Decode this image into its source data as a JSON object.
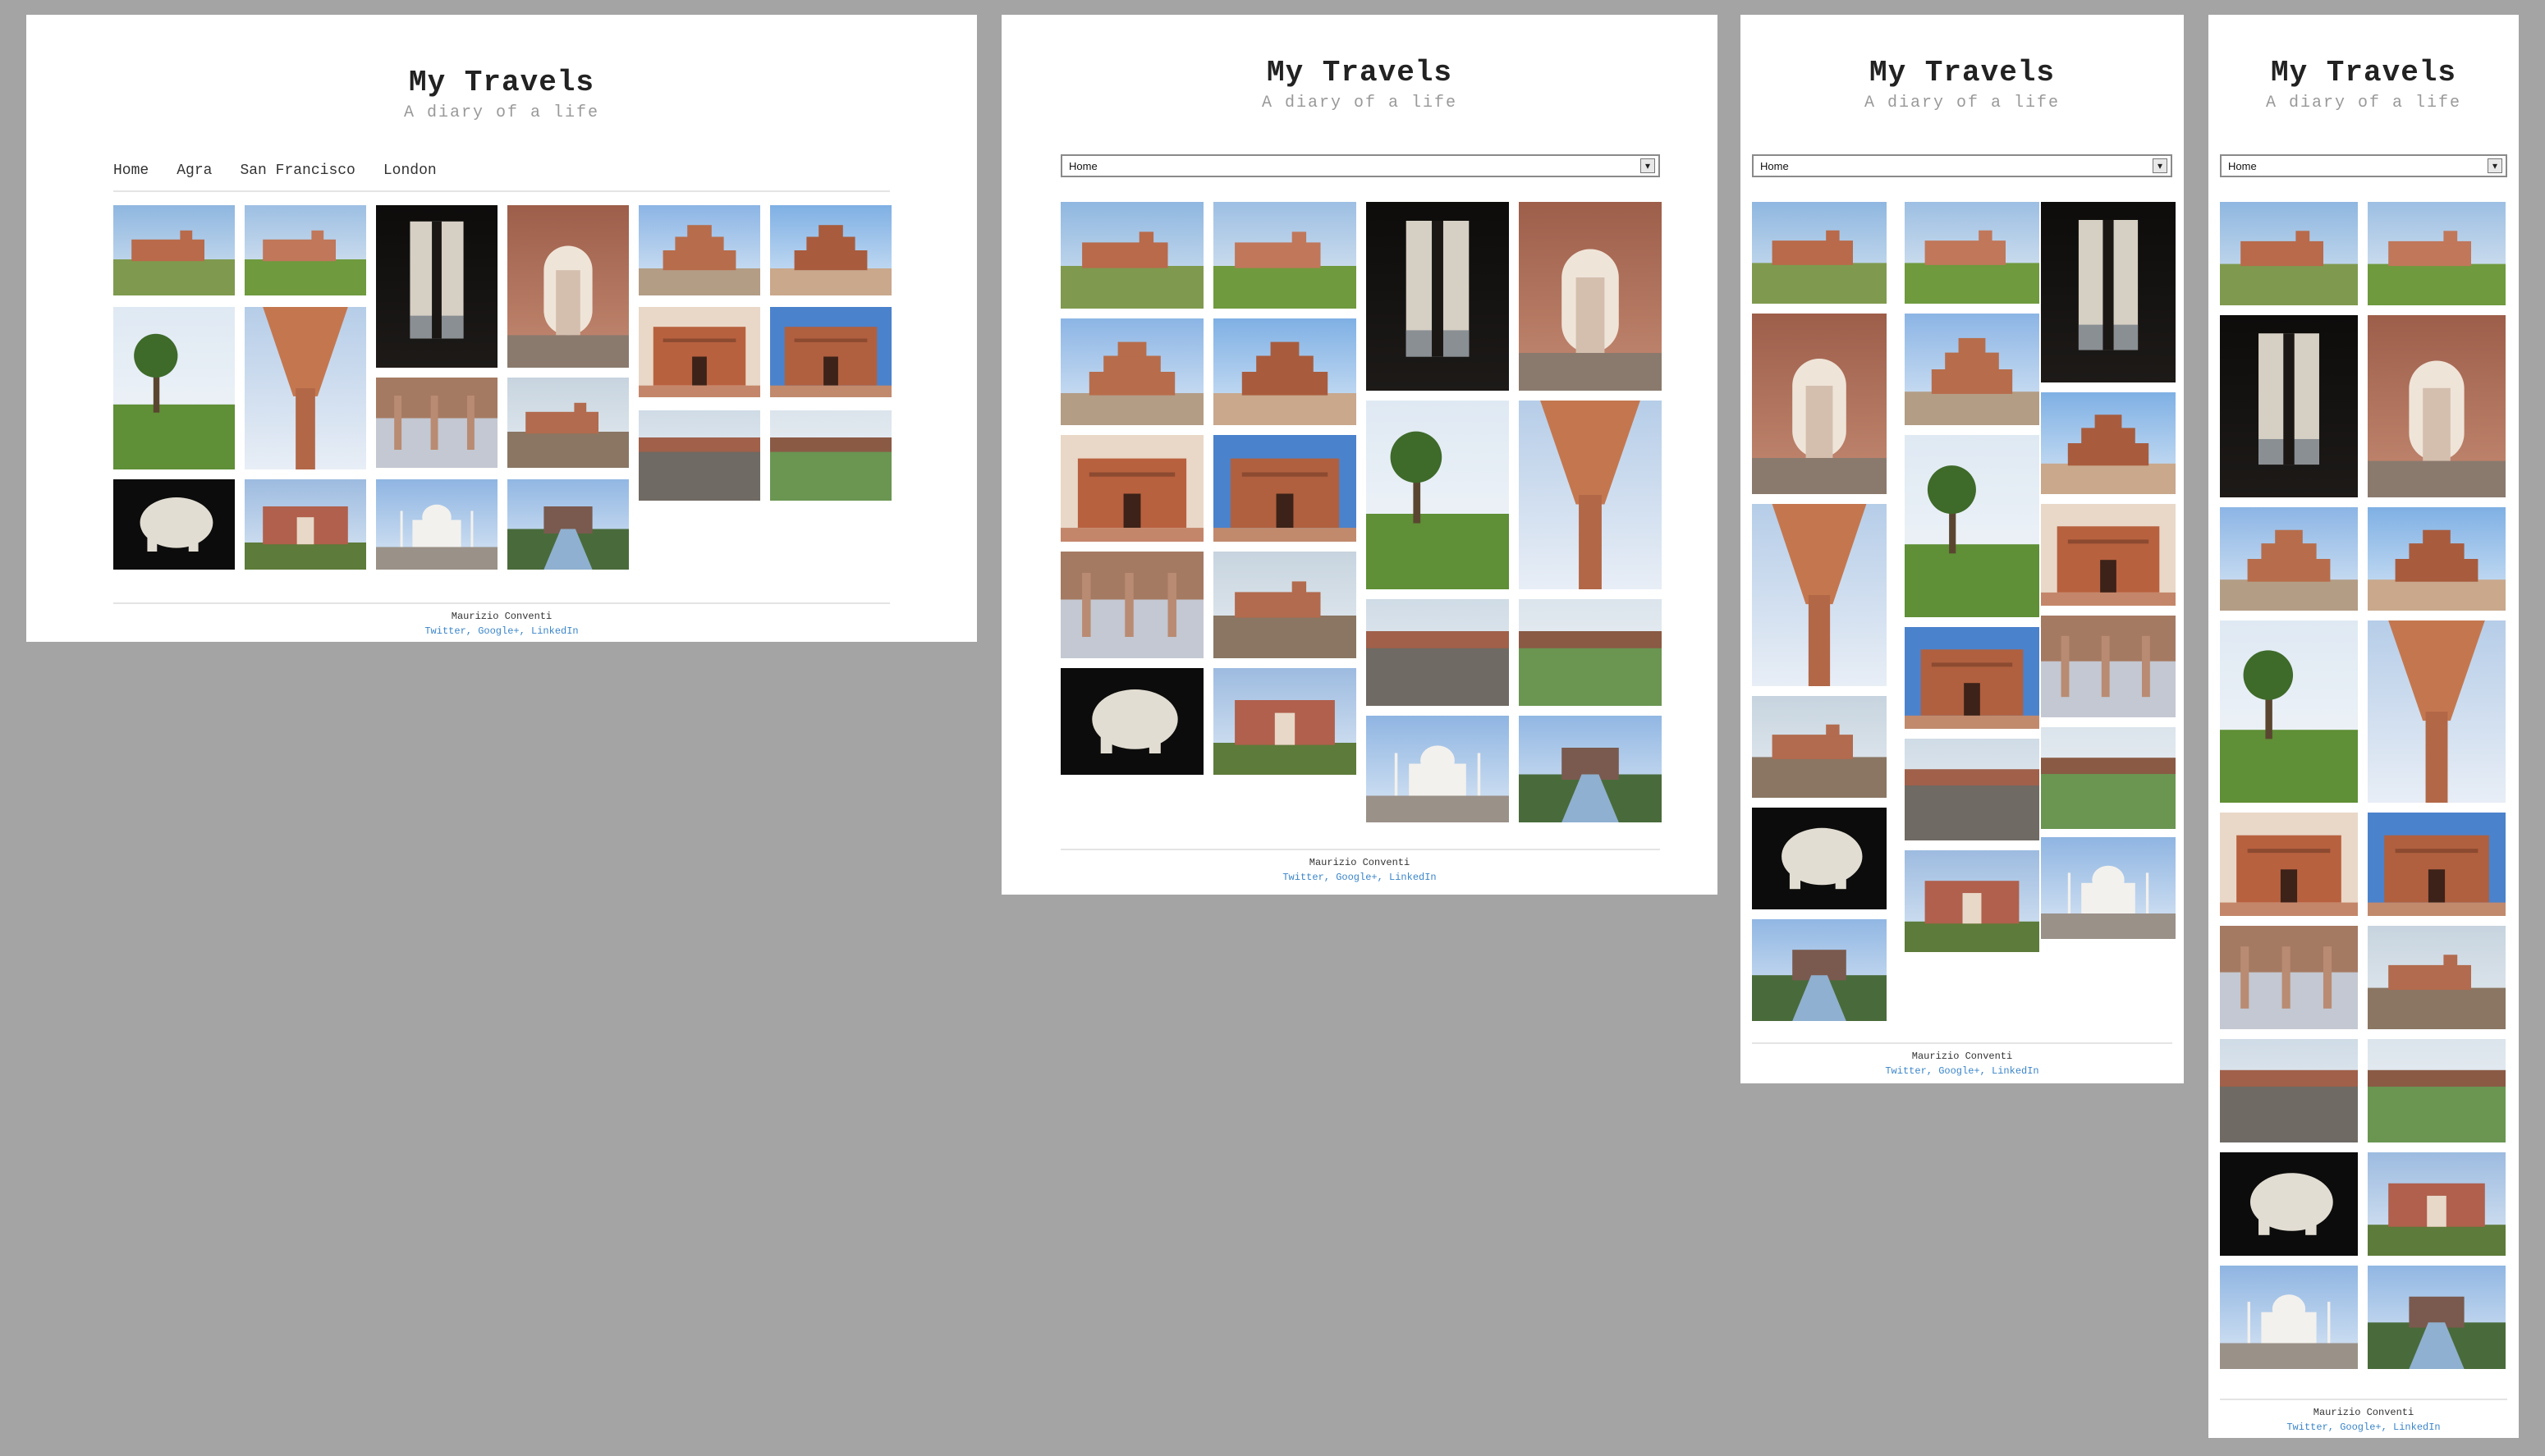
{
  "site": {
    "title": "My Travels",
    "subtitle": "A diary of a life"
  },
  "nav": {
    "items": [
      "Home",
      "Agra",
      "San Francisco",
      "London"
    ],
    "selected": "Home"
  },
  "footer": {
    "author": "Maurizio Conventi",
    "links": [
      "Twitter",
      "Google+",
      "LinkedIn"
    ],
    "separator": ","
  },
  "colors": {
    "background": "#a4a4a4",
    "panel": "#ffffff",
    "title": "#222222",
    "subtitle": "#999999",
    "link": "#3a85c9"
  },
  "photo_icons": [
    "palace-courtyard-photo",
    "palace-lawn-photo",
    "dark-arch-window-photo",
    "red-sandstone-arch-corridor-photo",
    "pavilion-photo",
    "five-story-palace-photo",
    "tree-lawn-photo",
    "carved-pillar-photo",
    "red-facade-photo",
    "blue-sky-facade-photo",
    "colonnade-hall-photo",
    "courtyard-ruins-photo",
    "courtyard-long-photo",
    "garden-pond-photo",
    "carved-elephant-photo",
    "red-gate-photo",
    "taj-mahal-photo",
    "reflecting-pool-photo"
  ]
}
